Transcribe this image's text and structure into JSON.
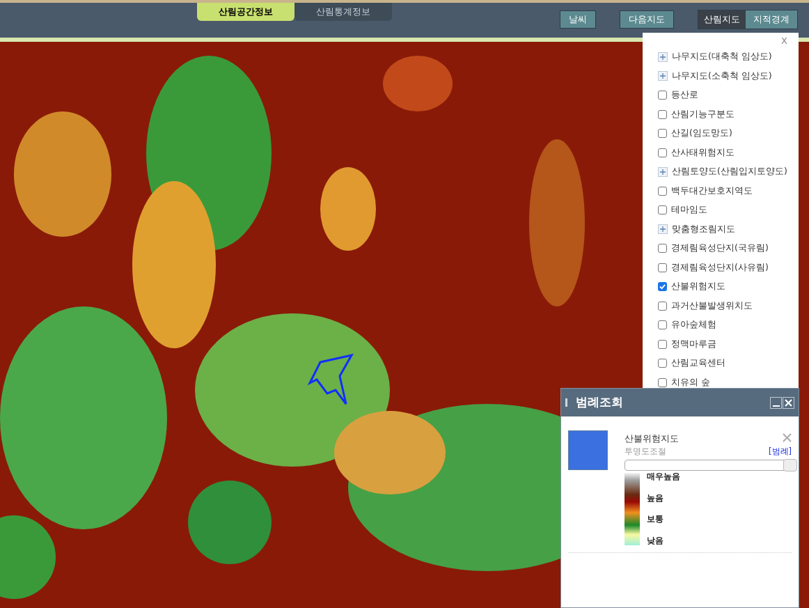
{
  "top_tabs": [
    {
      "label": "산림공간정보",
      "selected": true
    },
    {
      "label": "산림통계정보",
      "selected": false
    }
  ],
  "top_buttons": [
    "날씨",
    "다음지도"
  ],
  "map_switch": [
    {
      "label": "산림지도",
      "selected": true
    },
    {
      "label": "지적경계",
      "selected": false
    }
  ],
  "layer_panel": {
    "close": "X",
    "items": [
      {
        "kind": "group",
        "label": "나무지도(대축척 임상도)"
      },
      {
        "kind": "group",
        "label": "나무지도(소축척 임상도)"
      },
      {
        "kind": "check",
        "label": "등산로",
        "checked": false
      },
      {
        "kind": "check",
        "label": "산림기능구분도",
        "checked": false
      },
      {
        "kind": "check",
        "label": "산길(임도망도)",
        "checked": false
      },
      {
        "kind": "check",
        "label": "산사태위험지도",
        "checked": false
      },
      {
        "kind": "group",
        "label": "산림토양도(산림입지토양도)"
      },
      {
        "kind": "check",
        "label": "백두대간보호지역도",
        "checked": false
      },
      {
        "kind": "check",
        "label": "테마임도",
        "checked": false
      },
      {
        "kind": "group",
        "label": "맞춤형조림지도"
      },
      {
        "kind": "check",
        "label": "경제림육성단지(국유림)",
        "checked": false
      },
      {
        "kind": "check",
        "label": "경제림육성단지(사유림)",
        "checked": false
      },
      {
        "kind": "check",
        "label": "산불위험지도",
        "checked": true
      },
      {
        "kind": "check",
        "label": "과거산불발생위치도",
        "checked": false
      },
      {
        "kind": "check",
        "label": "유아숲체험",
        "checked": false
      },
      {
        "kind": "check",
        "label": "정맥마루금",
        "checked": false
      },
      {
        "kind": "check",
        "label": "산림교육센터",
        "checked": false
      },
      {
        "kind": "check",
        "label": "치유의 숲",
        "checked": false
      }
    ]
  },
  "legend_window": {
    "title": "범례조회",
    "layer": {
      "name": "산불위험지도",
      "opacity_label": "투명도조절",
      "legend_link": "[범례]",
      "level": 1.0,
      "classes": [
        "매우높음",
        "높음",
        "보통",
        "낮음"
      ]
    }
  }
}
